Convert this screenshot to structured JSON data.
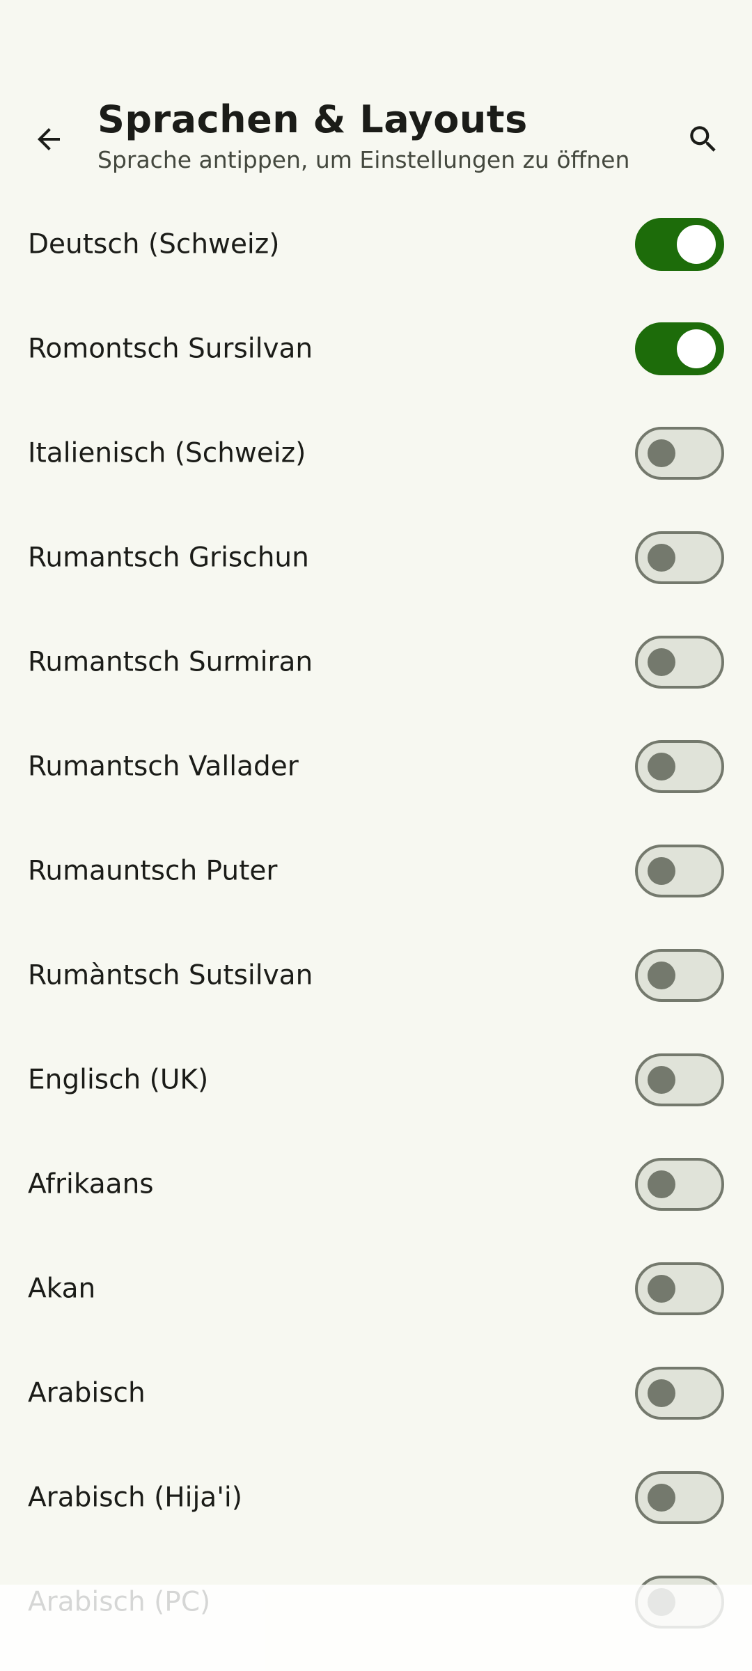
{
  "header": {
    "title": "Sprachen & Layouts",
    "subtitle": "Sprache antippen, um Einstellungen zu öffnen",
    "back_icon": "arrow-back-icon",
    "search_icon": "search-icon"
  },
  "colors": {
    "background": "#f7f8f1",
    "switch_on": "#1d6c0a",
    "switch_off_track": "#e0e3d9",
    "switch_off_outline": "#74796d"
  },
  "languages": [
    {
      "label": "Deutsch (Schweiz)",
      "enabled": true
    },
    {
      "label": "Romontsch Sursilvan",
      "enabled": true
    },
    {
      "label": "Italienisch (Schweiz)",
      "enabled": false
    },
    {
      "label": "Rumantsch Grischun",
      "enabled": false
    },
    {
      "label": "Rumantsch Surmiran",
      "enabled": false
    },
    {
      "label": "Rumantsch Vallader",
      "enabled": false
    },
    {
      "label": "Rumauntsch Puter",
      "enabled": false
    },
    {
      "label": "Rumàntsch Sutsilvan",
      "enabled": false
    },
    {
      "label": "Englisch (UK)",
      "enabled": false
    },
    {
      "label": "Afrikaans",
      "enabled": false
    },
    {
      "label": "Akan",
      "enabled": false
    },
    {
      "label": "Arabisch",
      "enabled": false
    },
    {
      "label": "Arabisch (Hija'i)",
      "enabled": false
    },
    {
      "label": "Arabisch (PC)",
      "enabled": false
    }
  ]
}
